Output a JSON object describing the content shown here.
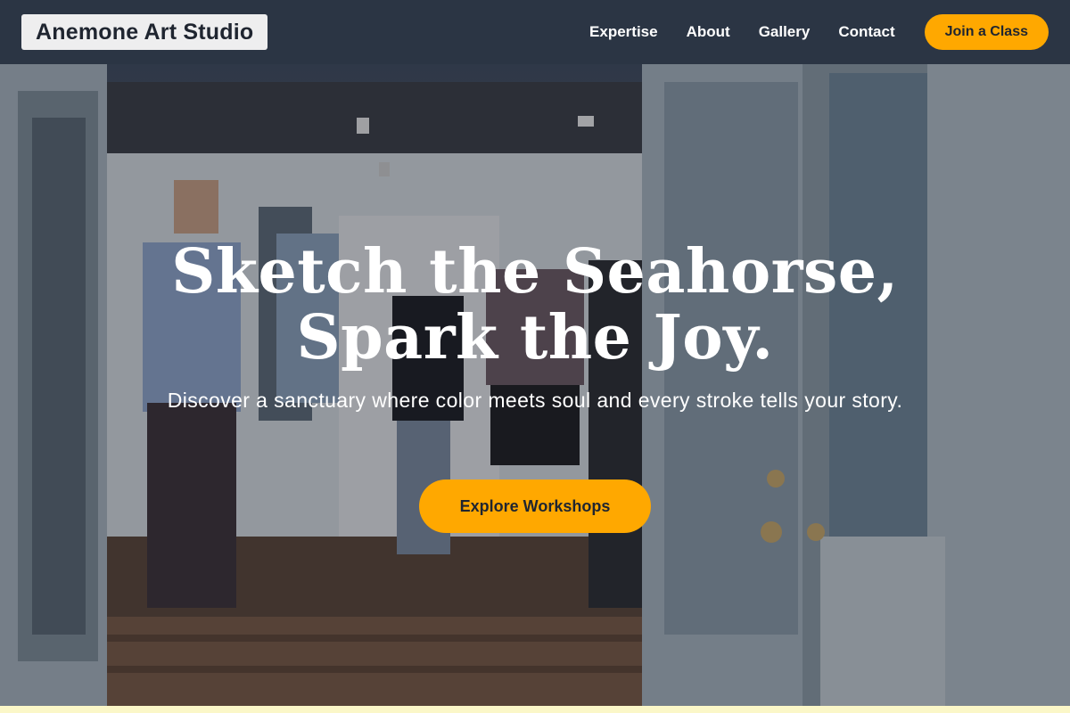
{
  "brand": {
    "name": "Anemone Art Studio"
  },
  "nav": {
    "links": [
      "Expertise",
      "About",
      "Gallery",
      "Contact"
    ],
    "cta_label": "Join a Class"
  },
  "hero": {
    "headline_line1": "Sketch the Seahorse,",
    "headline_line2": "Spark the Joy.",
    "subheadline": "Discover a sanctuary where color meets soul and every stroke tells your story.",
    "cta_label": "Explore Workshops",
    "image_description": "Open studio doors revealing people gathered inside a gallery space"
  },
  "colors": {
    "nav_background": "#2b3544",
    "accent": "#ffa800",
    "logo_background": "#eeeeef",
    "bottom_strip": "#fbf7c8"
  }
}
